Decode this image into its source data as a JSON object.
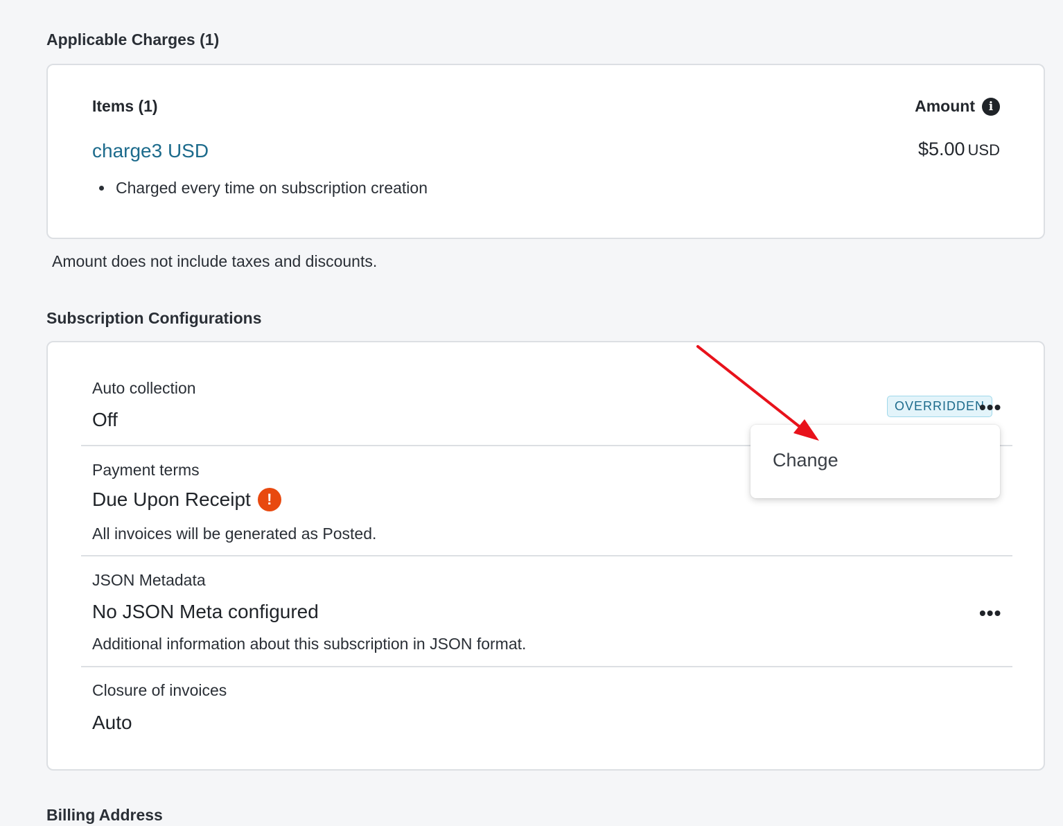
{
  "charges": {
    "heading": "Applicable Charges (1)",
    "items_header": "Items (1)",
    "amount_header": "Amount",
    "item": {
      "name": "charge3 USD",
      "amount": "$5.00",
      "currency": "USD",
      "detail": "Charged every time on subscription creation"
    },
    "note": "Amount does not include taxes and discounts."
  },
  "config": {
    "heading": "Subscription Configurations",
    "auto_collection": {
      "label": "Auto collection",
      "value": "Off",
      "badge": "OVERRIDDEN"
    },
    "payment_terms": {
      "label": "Payment terms",
      "value": "Due Upon Receipt",
      "description": "All invoices will be generated as Posted."
    },
    "json_metadata": {
      "label": "JSON Metadata",
      "value": "No JSON Meta configured",
      "description": "Additional information about this subscription in JSON format."
    },
    "closure": {
      "label": "Closure of invoices",
      "value": "Auto"
    },
    "more_glyph": "•••",
    "info_glyph": "i",
    "warning_glyph": "!"
  },
  "menu": {
    "change_label": "Change"
  },
  "billing": {
    "heading": "Billing Address"
  },
  "colors": {
    "link": "#1d6b8c",
    "warning": "#e8490f",
    "badge_bg": "#e3f4fa",
    "annotation_arrow": "#e8121b"
  },
  "icons": {
    "info": "info-circle-icon",
    "warning": "exclamation-circle-icon",
    "more": "more-horizontal-icon",
    "annotation": "red-arrow-annotation"
  }
}
